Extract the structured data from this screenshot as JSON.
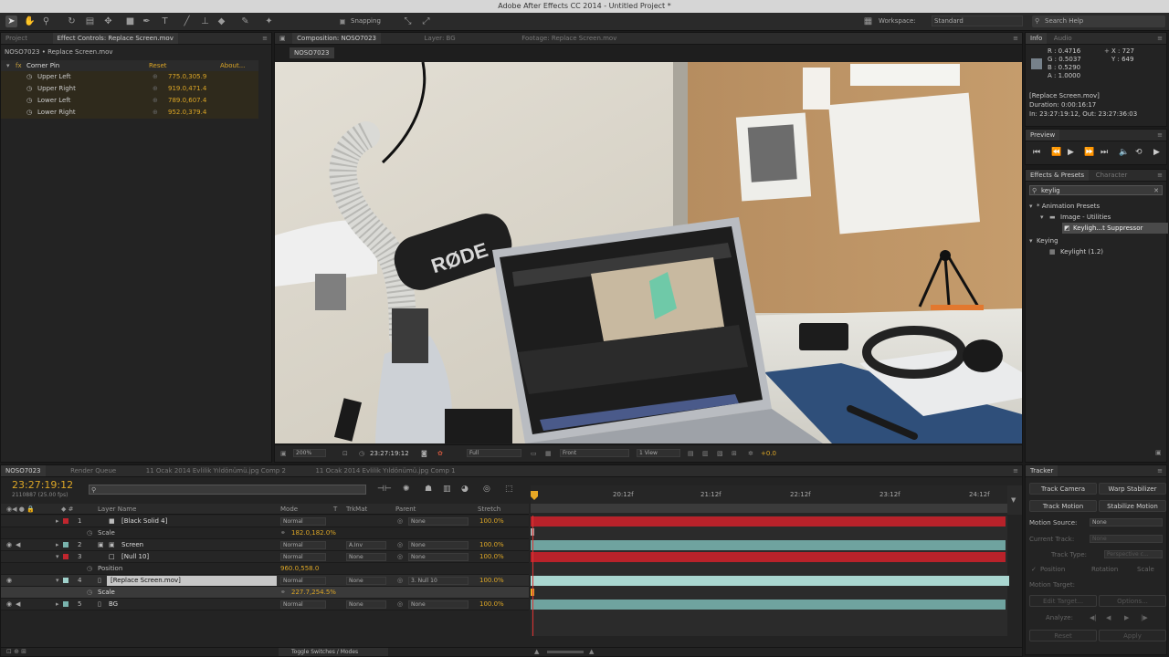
{
  "app": {
    "title": "Adobe After Effects CC 2014 - Untitled Project *"
  },
  "toolbar": {
    "snapping": "Snapping",
    "workspace_label": "Workspace:",
    "workspace_value": "Standard",
    "search_placeholder": "Search Help"
  },
  "left_panel": {
    "tabs": [
      "Project",
      "Effect Controls: Replace Screen.mov"
    ],
    "header": "NOSO7023 • Replace Screen.mov",
    "effect": {
      "name": "Corner Pin",
      "reset": "Reset",
      "about": "About..."
    },
    "params": [
      {
        "name": "Upper Left",
        "value": "775.0,305.9"
      },
      {
        "name": "Upper Right",
        "value": "919.0,471.4"
      },
      {
        "name": "Lower Left",
        "value": "789.0,607.4"
      },
      {
        "name": "Lower Right",
        "value": "952.0,379.4"
      }
    ]
  },
  "comp_panel": {
    "tabs": [
      "Composition: NOSO7023",
      "Layer: BG",
      "Footage: Replace Screen.mov"
    ],
    "subtab": "NOSO7023",
    "footer": {
      "zoom": "200%",
      "timecode": "23:27:19:12",
      "resolution": "Full",
      "view": "Front",
      "views": "1 View",
      "exposure": "+0.0"
    },
    "scene": {
      "mic_brand": "RØDE"
    }
  },
  "info_panel": {
    "tabs": [
      "Info",
      "Audio"
    ],
    "r": "R : 0.4716",
    "g": "G : 0.5037",
    "b": "B : 0.5290",
    "a": "A : 1.0000",
    "x": "X : 727",
    "y": "Y : 649",
    "file": "[Replace Screen.mov]",
    "duration": "Duration: 0:00:16:17",
    "inout": "In: 23:27:19:12, Out: 23:27:36:03"
  },
  "preview_panel": {
    "title": "Preview"
  },
  "effects_panel": {
    "tabs": [
      "Effects & Presets",
      "Character"
    ],
    "search_value": "keylig",
    "tree": [
      {
        "label": "* Animation Presets",
        "indent": 0
      },
      {
        "label": "Image - Utilities",
        "indent": 1
      },
      {
        "label": "Keyligh...t Suppressor",
        "indent": 2
      },
      {
        "label": "Keying",
        "indent": 0
      },
      {
        "label": "Keylight (1.2)",
        "indent": 1
      }
    ]
  },
  "tracker_panel": {
    "title": "Tracker",
    "track_camera": "Track Camera",
    "warp_stabilizer": "Warp Stabilizer",
    "track_motion": "Track Motion",
    "stabilize_motion": "Stabilize Motion",
    "motion_source_label": "Motion Source:",
    "motion_source_value": "None",
    "current_track_label": "Current Track:",
    "current_track_value": "None",
    "track_type_label": "Track Type:",
    "track_type_value": "Perspective c...",
    "position": "Position",
    "rotation": "Rotation",
    "scale": "Scale",
    "motion_target": "Motion Target:",
    "edit_target": "Edit Target...",
    "options": "Options...",
    "analyze": "Analyze:",
    "reset": "Reset",
    "apply": "Apply"
  },
  "timeline": {
    "tabs": [
      "NOSO7023",
      "Render Queue",
      "11 Ocak 2014 Evlilik Yıldönümü.jpg Comp 2",
      "11 Ocak 2014 Evlilik Yıldönümü.jpg Comp 1"
    ],
    "timecode": "23:27:19:12",
    "frame": "2110887 (25.00 fps)",
    "columns": {
      "layer_name": "Layer Name",
      "mode": "Mode",
      "t": "T",
      "trkmat": "TrkMat",
      "parent": "Parent",
      "stretch": "Stretch"
    },
    "ruler": [
      "20:12f",
      "21:12f",
      "22:12f",
      "23:12f",
      "24:12f"
    ],
    "toggle": "Toggle Switches / Modes",
    "layers": [
      {
        "num": "1",
        "name": "[Black Solid 4]",
        "mode": "Normal",
        "trkmat": "",
        "parent": "None",
        "stretch": "100.0%",
        "color": "#b8222a",
        "label": "#c0262e"
      },
      {
        "prop": "Scale",
        "value": "182.0,182.0%"
      },
      {
        "num": "2",
        "name": "Screen",
        "mode": "Normal",
        "trkmat": "A.Inv",
        "parent": "None",
        "stretch": "100.0%",
        "color": "#6fa39f",
        "label": "#79b3ad"
      },
      {
        "num": "3",
        "name": "[Null 10]",
        "mode": "Normal",
        "trkmat": "None",
        "parent": "None",
        "stretch": "100.0%",
        "color": "#b8222a",
        "label": "#c0262e"
      },
      {
        "prop": "Position",
        "value": "960.0,558.0"
      },
      {
        "num": "4",
        "name": "[Replace Screen.mov]",
        "mode": "Normal",
        "trkmat": "None",
        "parent": "3. Null 10",
        "stretch": "100.0%",
        "color": "#a9d6d0",
        "label": "#9fd1cb",
        "selected": true
      },
      {
        "prop": "Scale",
        "value": "227.7,254.5%"
      },
      {
        "num": "5",
        "name": "BG",
        "mode": "Normal",
        "trkmat": "None",
        "parent": "None",
        "stretch": "100.0%",
        "color": "#6fa39f",
        "label": "#79b3ad"
      }
    ]
  }
}
